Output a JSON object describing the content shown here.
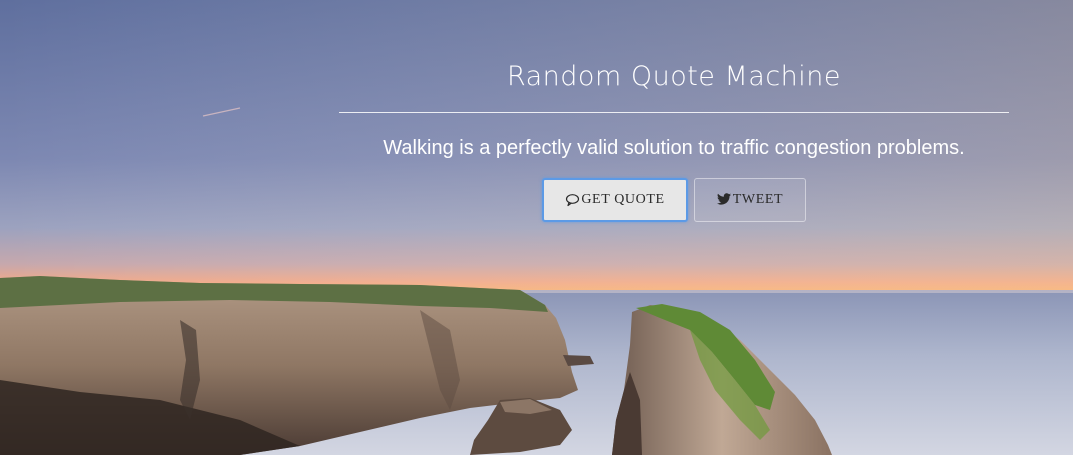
{
  "header": {
    "title": "Random Quote Machine"
  },
  "quote": {
    "text": "Walking is a perfectly valid solution to traffic congestion problems."
  },
  "buttons": {
    "get_quote": {
      "label": "GET QUOTE",
      "icon": "speech-bubble-icon"
    },
    "tweet": {
      "label": "TWEET",
      "icon": "twitter-icon"
    }
  },
  "colors": {
    "focus_ring": "#5c9ae6",
    "button_bg": "#e7e7e7",
    "text": "#ffffff"
  }
}
